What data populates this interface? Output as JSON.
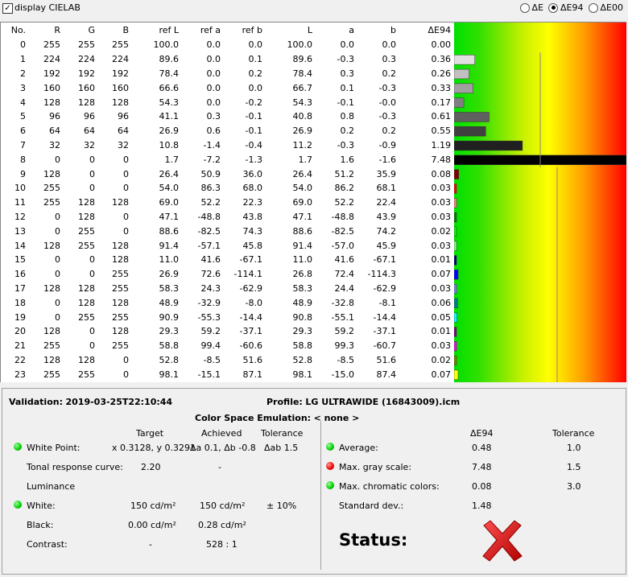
{
  "topbar": {
    "display_cielab_label": "display CIELAB",
    "radio_de": "ΔE",
    "radio_de94": "ΔE94",
    "radio_de00": "ΔE00",
    "selected": "ΔE94"
  },
  "table": {
    "headers": [
      "No.",
      "R",
      "G",
      "B",
      "ref L",
      "ref a",
      "ref b",
      "L",
      "a",
      "b",
      "ΔE94"
    ],
    "rows": [
      [
        "0",
        "255",
        "255",
        "255",
        "100.0",
        "0.0",
        "0.0",
        "100.0",
        "0.0",
        "0.0",
        "0.00"
      ],
      [
        "1",
        "224",
        "224",
        "224",
        "89.6",
        "0.0",
        "0.1",
        "89.6",
        "-0.3",
        "0.3",
        "0.36"
      ],
      [
        "2",
        "192",
        "192",
        "192",
        "78.4",
        "0.0",
        "0.2",
        "78.4",
        "0.3",
        "0.2",
        "0.26"
      ],
      [
        "3",
        "160",
        "160",
        "160",
        "66.6",
        "0.0",
        "0.0",
        "66.7",
        "0.1",
        "-0.3",
        "0.33"
      ],
      [
        "4",
        "128",
        "128",
        "128",
        "54.3",
        "0.0",
        "-0.2",
        "54.3",
        "-0.1",
        "-0.0",
        "0.17"
      ],
      [
        "5",
        "96",
        "96",
        "96",
        "41.1",
        "0.3",
        "-0.1",
        "40.8",
        "0.8",
        "-0.3",
        "0.61"
      ],
      [
        "6",
        "64",
        "64",
        "64",
        "26.9",
        "0.6",
        "-0.1",
        "26.9",
        "0.2",
        "0.2",
        "0.55"
      ],
      [
        "7",
        "32",
        "32",
        "32",
        "10.8",
        "-1.4",
        "-0.4",
        "11.2",
        "-0.3",
        "-0.9",
        "1.19"
      ],
      [
        "8",
        "0",
        "0",
        "0",
        "1.7",
        "-7.2",
        "-1.3",
        "1.7",
        "1.6",
        "-1.6",
        "7.48"
      ],
      [
        "9",
        "128",
        "0",
        "0",
        "26.4",
        "50.9",
        "36.0",
        "26.4",
        "51.2",
        "35.9",
        "0.08"
      ],
      [
        "10",
        "255",
        "0",
        "0",
        "54.0",
        "86.3",
        "68.0",
        "54.0",
        "86.2",
        "68.1",
        "0.03"
      ],
      [
        "11",
        "255",
        "128",
        "128",
        "69.0",
        "52.2",
        "22.3",
        "69.0",
        "52.2",
        "22.4",
        "0.03"
      ],
      [
        "12",
        "0",
        "128",
        "0",
        "47.1",
        "-48.8",
        "43.8",
        "47.1",
        "-48.8",
        "43.9",
        "0.03"
      ],
      [
        "13",
        "0",
        "255",
        "0",
        "88.6",
        "-82.5",
        "74.3",
        "88.6",
        "-82.5",
        "74.2",
        "0.02"
      ],
      [
        "14",
        "128",
        "255",
        "128",
        "91.4",
        "-57.1",
        "45.8",
        "91.4",
        "-57.0",
        "45.9",
        "0.03"
      ],
      [
        "15",
        "0",
        "0",
        "128",
        "11.0",
        "41.6",
        "-67.1",
        "11.0",
        "41.6",
        "-67.1",
        "0.01"
      ],
      [
        "16",
        "0",
        "0",
        "255",
        "26.9",
        "72.6",
        "-114.1",
        "26.8",
        "72.4",
        "-114.3",
        "0.07"
      ],
      [
        "17",
        "128",
        "128",
        "255",
        "58.3",
        "24.3",
        "-62.9",
        "58.3",
        "24.4",
        "-62.9",
        "0.03"
      ],
      [
        "18",
        "0",
        "128",
        "128",
        "48.9",
        "-32.9",
        "-8.0",
        "48.9",
        "-32.8",
        "-8.1",
        "0.06"
      ],
      [
        "19",
        "0",
        "255",
        "255",
        "90.9",
        "-55.3",
        "-14.4",
        "90.8",
        "-55.1",
        "-14.4",
        "0.05"
      ],
      [
        "20",
        "128",
        "0",
        "128",
        "29.3",
        "59.2",
        "-37.1",
        "29.3",
        "59.2",
        "-37.1",
        "0.01"
      ],
      [
        "21",
        "255",
        "0",
        "255",
        "58.8",
        "99.4",
        "-60.6",
        "58.8",
        "99.3",
        "-60.7",
        "0.03"
      ],
      [
        "22",
        "128",
        "128",
        "0",
        "52.8",
        "-8.5",
        "51.6",
        "52.8",
        "-8.5",
        "51.6",
        "0.02"
      ],
      [
        "23",
        "255",
        "255",
        "0",
        "98.1",
        "-15.1",
        "87.1",
        "98.1",
        "-15.0",
        "87.4",
        "0.07"
      ]
    ],
    "bar_colors": [
      "#ffffff",
      "#e0e0e0",
      "#c0c0c0",
      "#a0a0a0",
      "#808080",
      "#606060",
      "#404040",
      "#202020",
      "#000000",
      "#800000",
      "#ff0000",
      "#ff8080",
      "#008000",
      "#00ff00",
      "#80ff80",
      "#000080",
      "#0000ff",
      "#8080ff",
      "#008080",
      "#00ffff",
      "#800080",
      "#ff00ff",
      "#808000",
      "#ffff00"
    ],
    "bar_scale_max": 3.0
  },
  "summary": {
    "validation_label": "Validation:",
    "validation_value": "2019-03-25T22:10:44",
    "profile_label": "Profile:",
    "profile_value": "LG ULTRAWIDE (16843009).icm",
    "cse_label": "Color Space Emulation:",
    "cse_value": "< none >",
    "col_target": "Target",
    "col_achieved": "Achieved",
    "col_tolerance": "Tolerance",
    "white_point_label": "White Point:",
    "white_point_target": "x 0.3128, y 0.3291",
    "white_point_achieved": "Δa 0.1, Δb -0.8",
    "white_point_tolerance": "Δab 1.5",
    "trc_label": "Tonal response curve:",
    "trc_target": "2.20",
    "trc_achieved": "-",
    "luminance_label": "Luminance",
    "white_label": "White:",
    "white_target": "150 cd/m²",
    "white_achieved": "150 cd/m²",
    "white_tolerance": "± 10%",
    "black_label": "Black:",
    "black_target": "0.00 cd/m²",
    "black_achieved": "0.28 cd/m²",
    "contrast_label": "Contrast:",
    "contrast_target": "-",
    "contrast_achieved": "528 : 1",
    "right_col_de": "ΔE94",
    "right_col_tol": "Tolerance",
    "average_label": "Average:",
    "average_value": "0.48",
    "average_tol": "1.0",
    "maxgray_label": "Max. gray scale:",
    "maxgray_value": "7.48",
    "maxgray_tol": "1.5",
    "maxchroma_label": "Max. chromatic colors:",
    "maxchroma_value": "0.08",
    "maxchroma_tol": "3.0",
    "stddev_label": "Standard dev.:",
    "stddev_value": "1.48",
    "status_label": "Status:",
    "status_icon": "fail-x-icon"
  }
}
